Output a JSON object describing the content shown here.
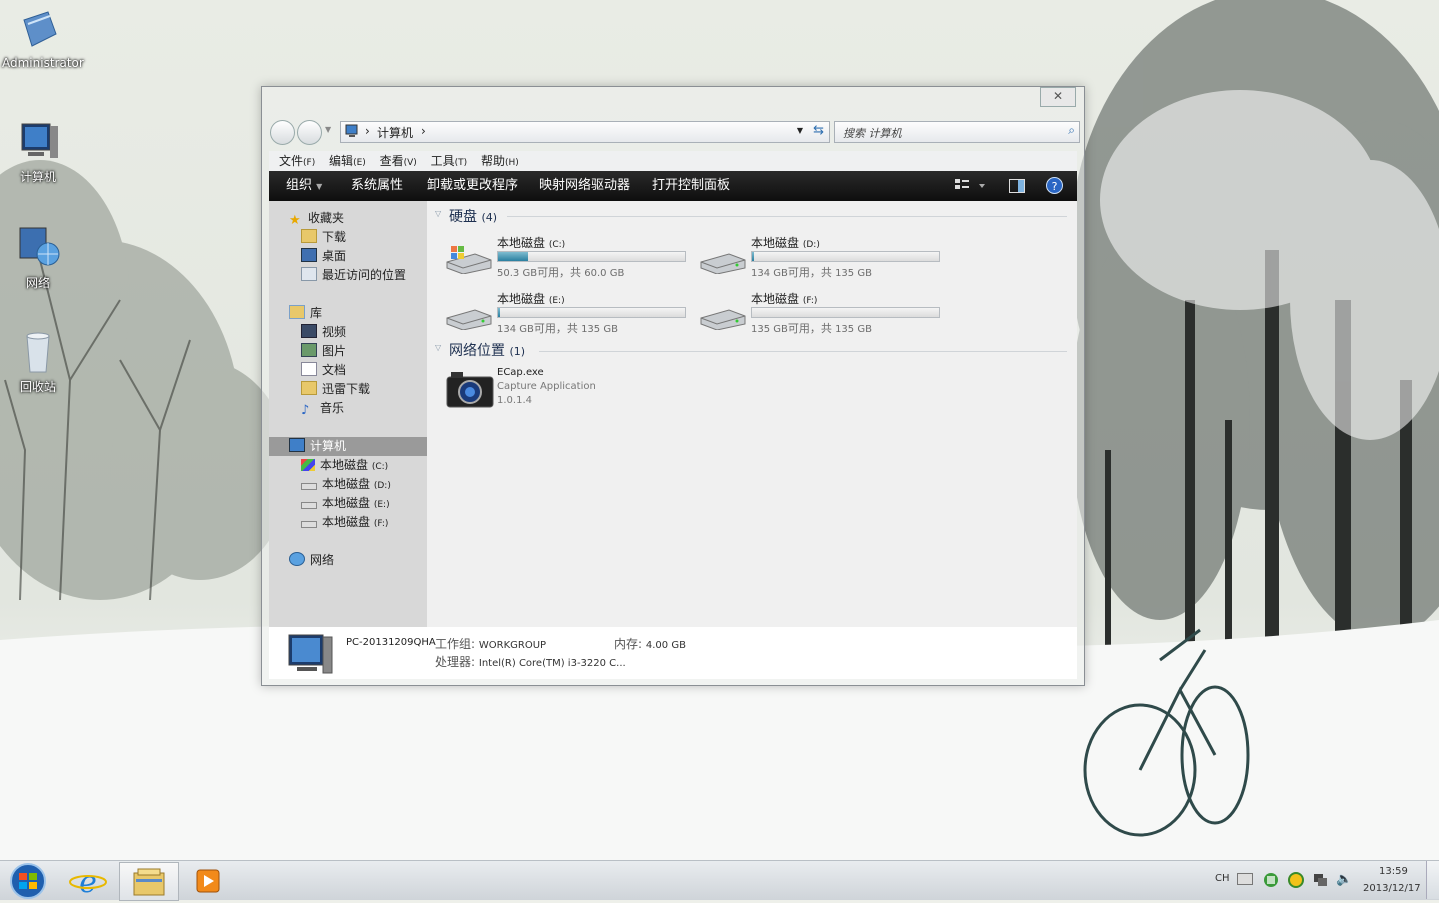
{
  "desktop": {
    "icons": [
      {
        "label": "Administrator"
      },
      {
        "label": "计算机"
      },
      {
        "label": "网络"
      },
      {
        "label": "回收站"
      }
    ]
  },
  "window": {
    "close_label": "✕",
    "breadcrumb": {
      "sep": "›",
      "location": "计算机"
    },
    "search_placeholder": "搜索 计算机",
    "menu": [
      {
        "label": "文件",
        "key": "(F)"
      },
      {
        "label": "编辑",
        "key": "(E)"
      },
      {
        "label": "查看",
        "key": "(V)"
      },
      {
        "label": "工具",
        "key": "(T)"
      },
      {
        "label": "帮助",
        "key": "(H)"
      }
    ],
    "toolbar": {
      "organize": "组织",
      "system_properties": "系统属性",
      "uninstall": "卸载或更改程序",
      "map_drive": "映射网络驱动器",
      "control_panel": "打开控制面板"
    },
    "sidebar": {
      "favorites": "收藏夹",
      "fav_items": [
        "下载",
        "桌面",
        "最近访问的位置"
      ],
      "libraries": "库",
      "lib_items": [
        "视频",
        "图片",
        "文档",
        "迅雷下载",
        "音乐"
      ],
      "computer": "计算机",
      "computer_items": [
        {
          "label": "本地磁盘",
          "drive": "(C:)"
        },
        {
          "label": "本地磁盘",
          "drive": "(D:)"
        },
        {
          "label": "本地磁盘",
          "drive": "(E:)"
        },
        {
          "label": "本地磁盘",
          "drive": "(F:)"
        }
      ],
      "network": "网络"
    },
    "content": {
      "hdd_group": {
        "label": "硬盘",
        "count": "(4)"
      },
      "drives": [
        {
          "name": "本地磁盘",
          "letter": "(C:)",
          "free": "50.3 GB",
          "free_text": "可用，共",
          "total": "60.0 GB",
          "used_fraction": 0.16
        },
        {
          "name": "本地磁盘",
          "letter": "(D:)",
          "free": "134 GB",
          "free_text": "可用，共",
          "total": "135 GB",
          "used_fraction": 0.01
        },
        {
          "name": "本地磁盘",
          "letter": "(E:)",
          "free": "134 GB",
          "free_text": "可用，共",
          "total": "135 GB",
          "used_fraction": 0.01
        },
        {
          "name": "本地磁盘",
          "letter": "(F:)",
          "free": "135 GB",
          "free_text": "可用，共",
          "total": "135 GB",
          "used_fraction": 0.0
        }
      ],
      "net_group": {
        "label": "网络位置",
        "count": "(1)"
      },
      "net_item": {
        "name": "ECap.exe",
        "desc": "Capture Application",
        "version": "1.0.1.4"
      }
    },
    "details": {
      "pc_name": "PC-20131209QHA",
      "workgroup_label": "工作组:",
      "workgroup": "WORKGROUP",
      "memory_label": "内存:",
      "memory": "4.00 GB",
      "cpu_label": "处理器:",
      "cpu": "Intel(R) Core(TM) i3-3220 C..."
    }
  },
  "taskbar": {
    "lang": "CH",
    "time": "13:59",
    "date": "2013/12/17"
  }
}
